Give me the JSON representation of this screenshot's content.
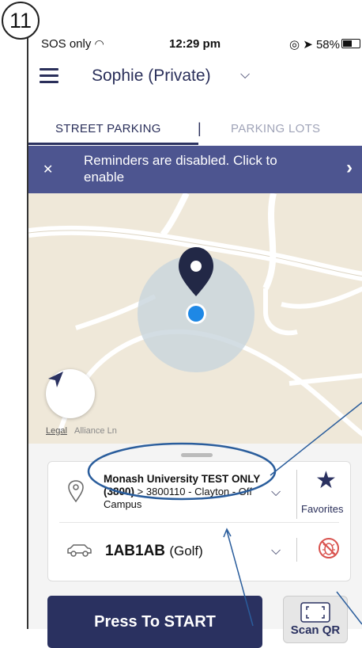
{
  "step_number": "11",
  "status_bar": {
    "carrier": "SOS only",
    "time": "12:29 pm",
    "battery": "58%",
    "battery_level": 0.58
  },
  "header": {
    "account_name": "Sophie (Private)",
    "menu_icon": "hamburger-icon",
    "chevron_icon": "chevron-down-icon"
  },
  "tabs": [
    {
      "label": "STREET PARKING",
      "active": true
    },
    {
      "label": "PARKING LOTS",
      "active": false
    }
  ],
  "tab_divider": "|",
  "banner": {
    "text": "Reminders are disabled. Click to enable",
    "close_icon": "close-icon",
    "arrow_icon": "chevron-right-icon"
  },
  "map": {
    "legal_label": "Legal",
    "street_name": "Alliance Ln",
    "locate_icon": "navigation-arrow-icon"
  },
  "zone": {
    "name": "Monash University TEST ONLY (3800)",
    "separator": ">",
    "code": "3800110 - Clayton - Off Campus",
    "pin_icon": "location-pin-icon"
  },
  "favorites": {
    "label": "Favorites",
    "icon": "star-icon"
  },
  "vehicle": {
    "plate": "1AB1AB",
    "model": "(Golf)",
    "car_icon": "car-icon",
    "status_icon": "no-bug-icon"
  },
  "actions": {
    "start_label": "Press To START",
    "scan_label": "Scan QR",
    "scan_icon": "qr-scan-icon"
  },
  "colors": {
    "primary": "#2a3160",
    "banner": "#4d5590",
    "accent_red": "#d9534f",
    "location_dot": "#1e88e5"
  }
}
